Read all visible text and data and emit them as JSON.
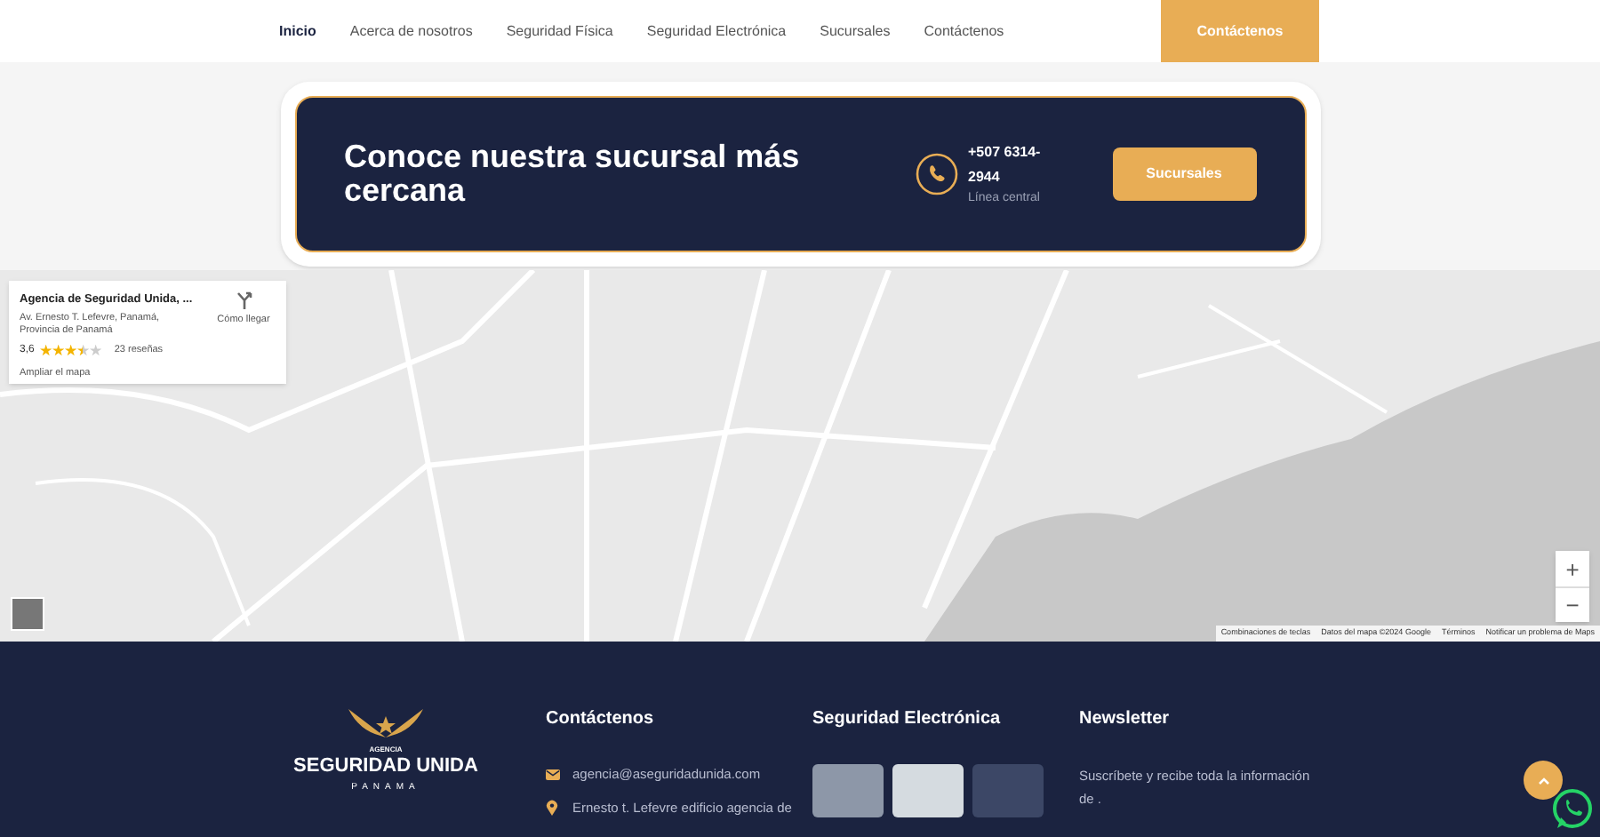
{
  "nav": {
    "links": [
      {
        "label": "Inicio",
        "selected": true
      },
      {
        "label": "Acerca de nosotros",
        "selected": false
      },
      {
        "label": "Seguridad Física",
        "selected": false
      },
      {
        "label": "Seguridad Electrónica",
        "selected": false
      },
      {
        "label": "Sucursales",
        "selected": false
      },
      {
        "label": "Contáctenos",
        "selected": false
      }
    ],
    "cta": "Contáctenos"
  },
  "banner": {
    "title": "Conoce nuestra sucursal más cercana",
    "phone": "+507 6314-2944",
    "phone_caption": "Línea central",
    "button": "Sucursales"
  },
  "map": {
    "place_card": {
      "name": "Agencia de Seguridad Unida, ...",
      "address": "Av. Ernesto T. Lefevre, Panamá, Provincia de Panamá",
      "rating": "3,6",
      "stars": 3.5,
      "reviews": "23 reseñas",
      "enlarge": "Ampliar el mapa",
      "directions": "Cómo llegar"
    },
    "zoom": [
      "+",
      "−"
    ],
    "attribution": [
      "Combinaciones de teclas",
      "Datos del mapa ©2024 Google",
      "Términos",
      "Notificar un problema de Maps"
    ]
  },
  "footer": {
    "logo": {
      "small": "AGENCIA",
      "name": "SEGURIDAD UNIDA",
      "country": "PANAMA"
    },
    "columns": [
      {
        "kind": "contact",
        "title": "Contáctenos",
        "items": [
          {
            "kind": "email",
            "text": "agencia@aseguridadunida.com"
          },
          {
            "kind": "address",
            "text": "Ernesto t. Lefevre edificio agencia de"
          }
        ]
      },
      {
        "kind": "gallery",
        "title": "Seguridad Electrónica"
      },
      {
        "kind": "newsletter",
        "title": "Newsletter",
        "text": "Suscríbete y recibe toda la información de ."
      }
    ]
  }
}
